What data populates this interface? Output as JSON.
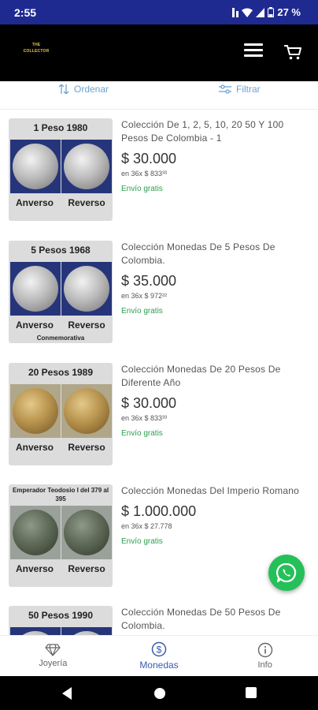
{
  "status": {
    "time": "2:55",
    "battery": "27 %"
  },
  "header": {
    "logo_line1": "THE",
    "logo_line2": "COLLECTOR"
  },
  "toolbar": {
    "order_label": "Ordenar",
    "filter_label": "Filtrar"
  },
  "products": [
    {
      "thumb_title": "1 Peso 1980",
      "thumb_left": "Anverso",
      "thumb_right": "Reverso",
      "thumb_note": "",
      "title": "Colección De 1, 2, 5, 10, 20 50 Y 100 Pesos De Colombia - 1",
      "price": "$ 30.000",
      "installments": "en 36x $ 833³³",
      "shipping": "Envío gratis"
    },
    {
      "thumb_title": "5 Pesos 1968",
      "thumb_left": "Anverso",
      "thumb_right": "Reverso",
      "thumb_note": "Conmemorativa",
      "title": "Colección Monedas De 5 Pesos De Colombia.",
      "price": "$ 35.000",
      "installments": "en 36x $ 972²²",
      "shipping": "Envío gratis"
    },
    {
      "thumb_title": "20 Pesos 1989",
      "thumb_left": "Anverso",
      "thumb_right": "Reverso",
      "thumb_note": "",
      "title": "Colección Monedas De 20 Pesos De Diferente Año",
      "price": "$ 30.000",
      "installments": "en 36x $ 833³³",
      "shipping": "Envío gratis"
    },
    {
      "thumb_title": "Emperador Teodosio I del 379 al 395",
      "thumb_left": "Anverso",
      "thumb_right": "Reverso",
      "thumb_note": "",
      "title": "Colección Monedas Del Imperio Romano",
      "price": "$ 1.000.000",
      "installments": "en 36x $ 27.778",
      "shipping": "Envío gratis"
    },
    {
      "thumb_title": "50 Pesos 1990",
      "thumb_left": "",
      "thumb_right": "",
      "thumb_note": "",
      "title": "Colección Monedas De 50 Pesos De Colombia.",
      "price": "",
      "installments": "",
      "shipping": ""
    }
  ],
  "bottom_nav": {
    "jewelry": "Joyería",
    "coins": "Monedas",
    "info": "Info"
  },
  "colors": {
    "status_bar": "#1e2a8f",
    "accent": "#3b5bb0",
    "shipping_green": "#2e9e4f",
    "whatsapp": "#25c05a"
  }
}
